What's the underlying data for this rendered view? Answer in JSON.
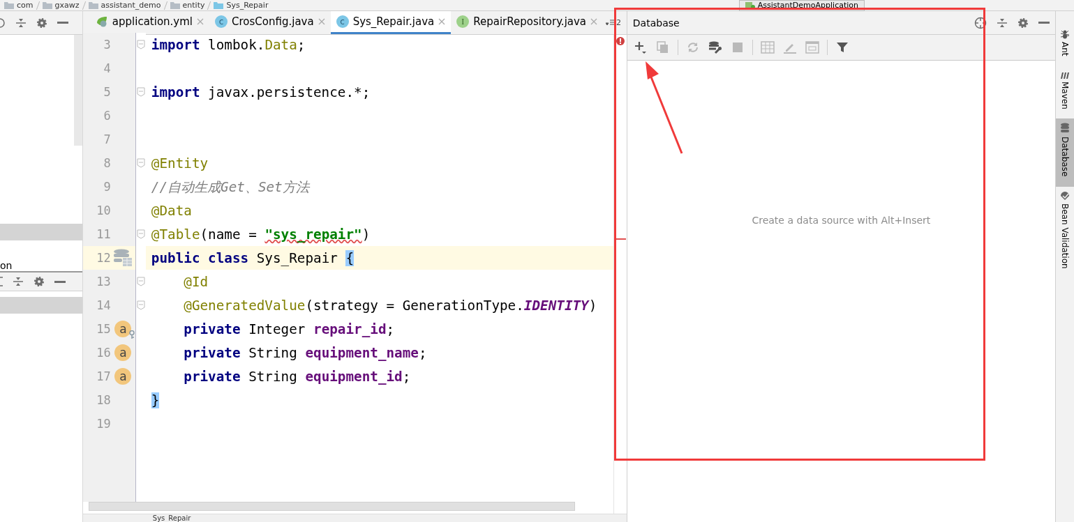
{
  "breadcrumbs": [
    "com",
    "gxawz",
    "assistant_demo",
    "entity",
    "Sys_Repair"
  ],
  "run_config": {
    "label": "AssistantDemoApplication"
  },
  "left_panel": {
    "cut_label": "on"
  },
  "tabs": [
    {
      "label": "application.yml",
      "kind": "spring",
      "selected": false
    },
    {
      "label": "CrosConfig.java",
      "kind": "class",
      "badge": "c",
      "selected": false
    },
    {
      "label": "Sys_Repair.java",
      "kind": "class",
      "badge": "c",
      "selected": true
    },
    {
      "label": "RepairRepository.java",
      "kind": "interface",
      "badge": "I",
      "selected": false
    }
  ],
  "tab_overflow": {
    "count": "2"
  },
  "code_lines": [
    {
      "number": "3",
      "fold": true,
      "current": false,
      "tokens": [
        {
          "kind": "keyword",
          "text": "import"
        },
        {
          "kind": "plain",
          "text": " lombok."
        },
        {
          "kind": "annotation",
          "text": "Data"
        },
        {
          "kind": "plain",
          "text": ";"
        }
      ]
    },
    {
      "number": "4",
      "fold": false,
      "current": false
    },
    {
      "number": "5",
      "fold": true,
      "current": false,
      "tokens": [
        {
          "kind": "keyword",
          "text": "import"
        },
        {
          "kind": "plain",
          "text": " javax.persistence.*;"
        }
      ]
    },
    {
      "number": "6",
      "fold": false,
      "current": false
    },
    {
      "number": "7",
      "fold": false,
      "current": false
    },
    {
      "number": "8",
      "fold": true,
      "current": false,
      "tokens": [
        {
          "kind": "annotation",
          "text": "@Entity"
        }
      ]
    },
    {
      "number": "9",
      "fold": false,
      "current": false,
      "tokens": [
        {
          "kind": "comment",
          "text": "//自动生成Get、Set方法"
        }
      ]
    },
    {
      "number": "10",
      "fold": false,
      "current": false,
      "tokens": [
        {
          "kind": "annotation",
          "text": "@Data"
        }
      ]
    },
    {
      "number": "11",
      "fold": true,
      "current": false,
      "tokens": [
        {
          "kind": "annotation",
          "text": "@Table"
        },
        {
          "kind": "plain",
          "text": "(name = "
        },
        {
          "kind": "string_typo",
          "text": "\"sys_repair\""
        },
        {
          "kind": "plain",
          "text": ")"
        }
      ]
    },
    {
      "number": "12",
      "fold": false,
      "current": true,
      "gutter": {
        "kind": "table"
      },
      "tokens": [
        {
          "kind": "keyword",
          "text": "public class"
        },
        {
          "kind": "plain",
          "text": " Sys_Repair "
        },
        {
          "kind": "brace_match",
          "text": "{"
        }
      ]
    },
    {
      "number": "13",
      "fold": true,
      "current": false,
      "tokens": [
        {
          "kind": "annotation",
          "text": "    @Id"
        }
      ]
    },
    {
      "number": "14",
      "fold": true,
      "current": false,
      "tokens": [
        {
          "kind": "annotation",
          "text": "    @GeneratedValue"
        },
        {
          "kind": "plain",
          "text": "(strategy = GenerationType."
        },
        {
          "kind": "constant",
          "text": "IDENTITY"
        },
        {
          "kind": "plain",
          "text": ")"
        }
      ]
    },
    {
      "number": "15",
      "fold": false,
      "current": false,
      "gutter": {
        "kind": "id_field",
        "label": "a"
      },
      "tokens": [
        {
          "kind": "keyword",
          "text": "    private"
        },
        {
          "kind": "plain",
          "text": " Integer "
        },
        {
          "kind": "field",
          "text": "repair_id"
        },
        {
          "kind": "plain",
          "text": ";"
        }
      ]
    },
    {
      "number": "16",
      "fold": false,
      "current": false,
      "gutter": {
        "kind": "field",
        "label": "a"
      },
      "tokens": [
        {
          "kind": "keyword",
          "text": "    private"
        },
        {
          "kind": "plain",
          "text": " String "
        },
        {
          "kind": "field",
          "text": "equipment_name"
        },
        {
          "kind": "plain",
          "text": ";"
        }
      ]
    },
    {
      "number": "17",
      "fold": false,
      "current": false,
      "gutter": {
        "kind": "field",
        "label": "a"
      },
      "tokens": [
        {
          "kind": "keyword",
          "text": "    private"
        },
        {
          "kind": "plain",
          "text": " String "
        },
        {
          "kind": "field",
          "text": "equipment_id"
        },
        {
          "kind": "plain",
          "text": ";"
        }
      ]
    },
    {
      "number": "18",
      "fold": false,
      "current": false,
      "tokens": [
        {
          "kind": "brace_match",
          "text": "}"
        }
      ]
    },
    {
      "number": "19",
      "fold": false,
      "current": false
    }
  ],
  "database": {
    "title": "Database",
    "empty_text": "Create a data source with Alt+Insert",
    "toolbar": [
      {
        "kind": "add",
        "disabled": false
      },
      {
        "kind": "copy",
        "disabled": true
      },
      {
        "kind": "separator"
      },
      {
        "kind": "refresh",
        "disabled": true
      },
      {
        "kind": "db_settings",
        "disabled": false
      },
      {
        "kind": "stop",
        "disabled": true
      },
      {
        "kind": "separator"
      },
      {
        "kind": "table",
        "disabled": true
      },
      {
        "kind": "edit",
        "disabled": true
      },
      {
        "kind": "console",
        "disabled": true
      },
      {
        "kind": "separator"
      },
      {
        "kind": "filter",
        "disabled": false
      }
    ]
  },
  "side_tabs": [
    {
      "label": "Ant",
      "kind": "ant",
      "selected": false
    },
    {
      "label": "Maven",
      "kind": "maven",
      "selected": false
    },
    {
      "label": "Database",
      "kind": "database",
      "selected": true
    },
    {
      "label": "Bean Validation",
      "kind": "bean",
      "selected": false
    }
  ],
  "status": {
    "file": "Sys_Repair"
  }
}
